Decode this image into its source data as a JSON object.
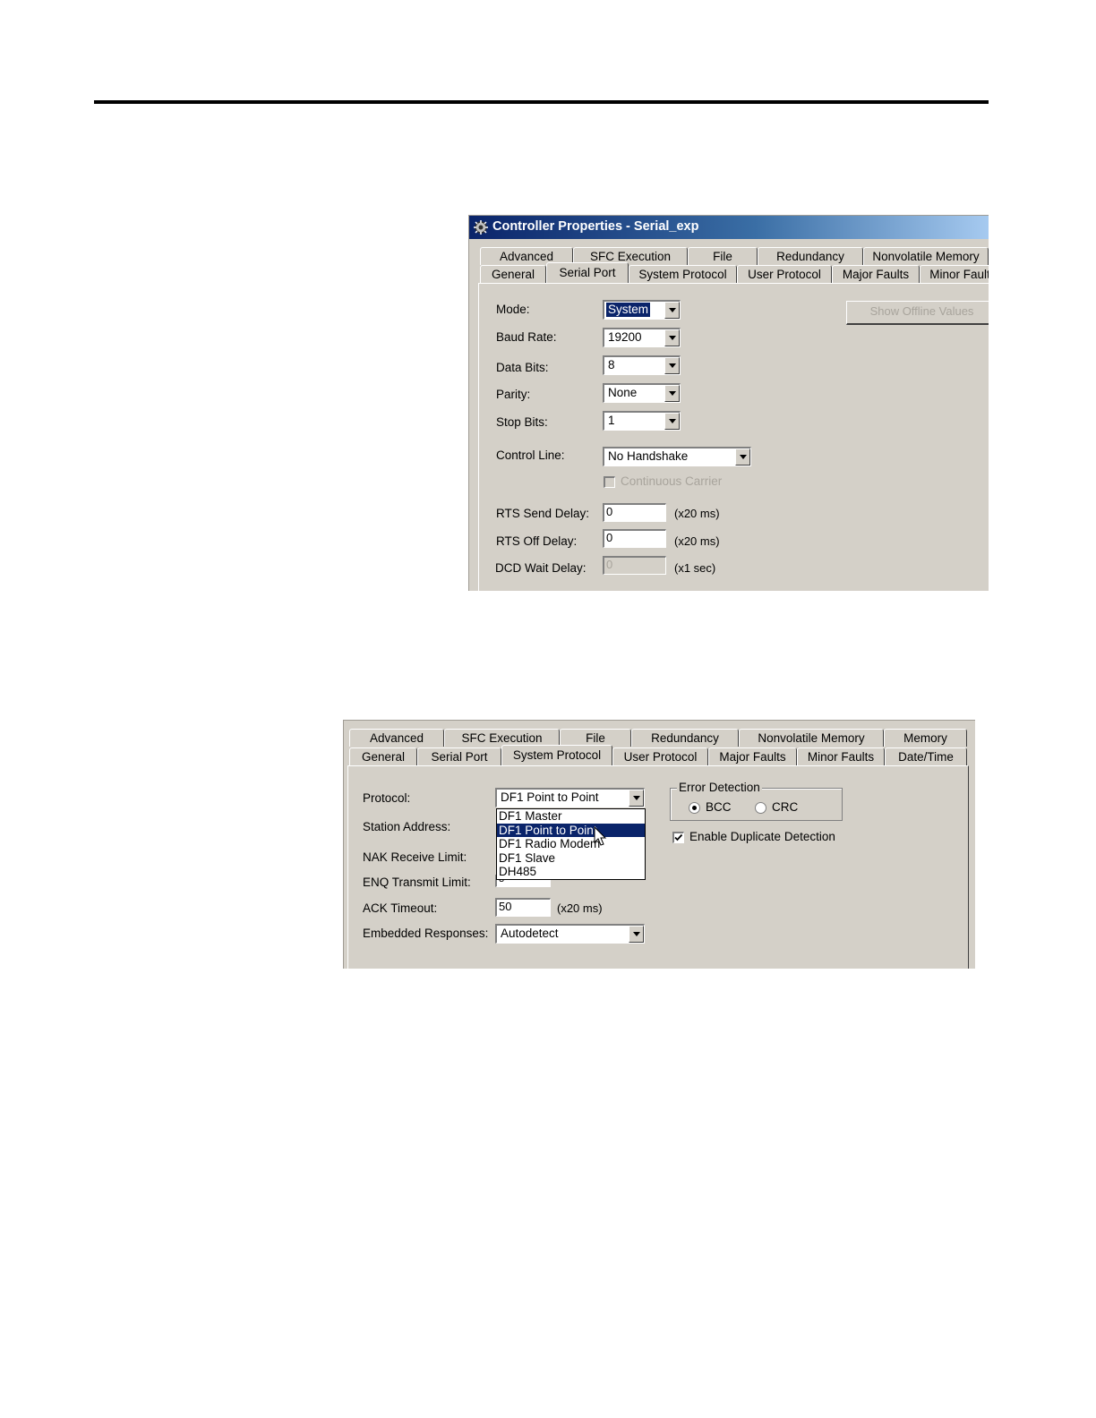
{
  "dialog1": {
    "title": "Controller Properties - Serial_exp",
    "tabs_row1": [
      "Advanced",
      "SFC Execution",
      "File",
      "Redundancy",
      "Nonvolatile Memory"
    ],
    "tabs_row2": [
      "General",
      "Serial Port",
      "System Protocol",
      "User Protocol",
      "Major Faults",
      "Minor Fault"
    ],
    "active_tab": "Serial Port",
    "show_offline_values": "Show Offline Values",
    "mode": {
      "label": "Mode:",
      "value": "System"
    },
    "baud_rate": {
      "label": "Baud Rate:",
      "value": "19200"
    },
    "data_bits": {
      "label": "Data Bits:",
      "value": "8"
    },
    "parity": {
      "label": "Parity:",
      "value": "None"
    },
    "stop_bits": {
      "label": "Stop Bits:",
      "value": "1"
    },
    "control_line": {
      "label": "Control Line:",
      "value": "No Handshake"
    },
    "continuous_carrier": {
      "label": "Continuous Carrier",
      "checked": false,
      "enabled": false
    },
    "rts_send_delay": {
      "label": "RTS Send Delay:",
      "value": "0",
      "unit": "(x20 ms)"
    },
    "rts_off_delay": {
      "label": "RTS Off Delay:",
      "value": "0",
      "unit": "(x20 ms)"
    },
    "dcd_wait_delay": {
      "label": "DCD Wait Delay:",
      "value": "0",
      "unit": "(x1 sec)"
    }
  },
  "dialog2": {
    "tabs_row1": [
      "Advanced",
      "SFC Execution",
      "File",
      "Redundancy",
      "Nonvolatile Memory",
      "Memory"
    ],
    "tabs_row2": [
      "General",
      "Serial Port",
      "System Protocol",
      "User Protocol",
      "Major Faults",
      "Minor Faults",
      "Date/Time"
    ],
    "active_tab": "System Protocol",
    "protocol": {
      "label": "Protocol:",
      "value": "DF1 Point to Point"
    },
    "protocol_options": [
      "DF1 Master",
      "DF1 Point to Point",
      "DF1 Radio Modem",
      "DF1 Slave",
      "DH485"
    ],
    "highlighted_option": "DF1 Point to Point",
    "station_address": {
      "label": "Station Address:"
    },
    "nak_receive_limit": {
      "label": "NAK Receive Limit:"
    },
    "enq_transmit_limit": {
      "label": "ENQ Transmit Limit:",
      "value": "3"
    },
    "ack_timeout": {
      "label": "ACK Timeout:",
      "value": "50",
      "unit": "(x20 ms)"
    },
    "embedded_responses": {
      "label": "Embedded Responses:",
      "value": "Autodetect"
    },
    "error_detection": {
      "title": "Error Detection",
      "options": [
        "BCC",
        "CRC"
      ],
      "selected": "BCC"
    },
    "enable_duplicate_detection": {
      "label": "Enable Duplicate Detection",
      "checked": true
    }
  },
  "colors": {
    "dialog_face": "#d4d0c8",
    "selection": "#0a246a",
    "title_start": "#0a246a",
    "title_end": "#a6caf0"
  }
}
